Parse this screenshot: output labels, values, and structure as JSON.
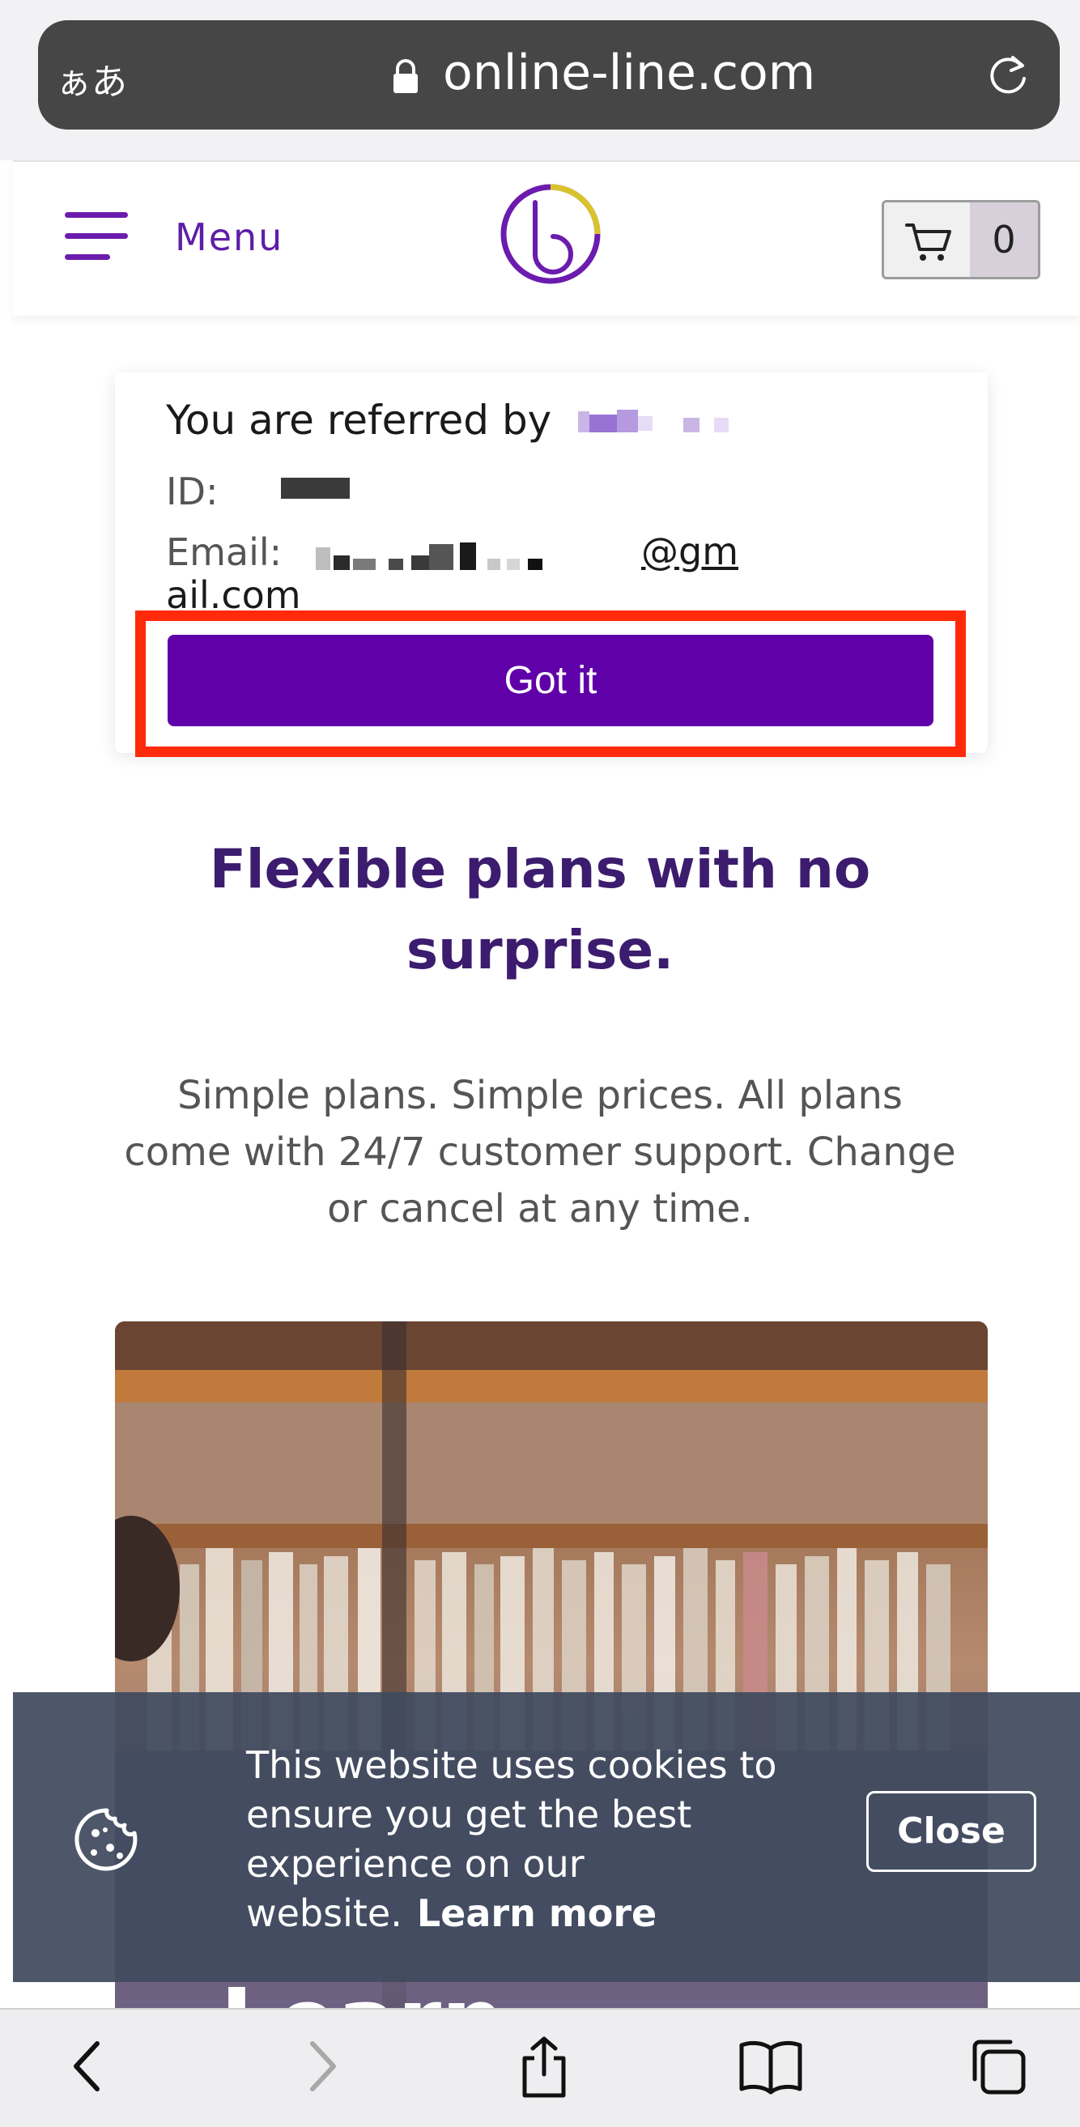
{
  "browser": {
    "text_size_label": "ぁあ",
    "url": "online-line.com"
  },
  "header": {
    "menu_label": "Menu",
    "cart_count": "0"
  },
  "referral": {
    "title": "You are referred by",
    "id_label": "ID:",
    "email_label": "Email:",
    "email_domain_part1": "@gm",
    "email_domain_part2": "ail.com",
    "button_label": "Got it"
  },
  "hero": {
    "headline": "Flexible plans with no surprise.",
    "subtext": "Simple plans. Simple prices. All plans come with 24/7 customer support. Change or cancel at any time."
  },
  "photo_card": {
    "overlay_text_partial": "Learn"
  },
  "cookie_banner": {
    "message": "This website uses cookies to ensure you get the best experience on our website.",
    "learn_more": "Learn more",
    "close_label": "Close"
  },
  "colors": {
    "brand_purple": "#5f00a8",
    "headline_purple": "#3c1c6e",
    "highlight_red": "#ff2a0a",
    "cookie_bg": "#3f4a5e"
  },
  "toolbar_icons": [
    "back-icon",
    "forward-icon",
    "share-icon",
    "bookmarks-icon",
    "tabs-icon"
  ]
}
